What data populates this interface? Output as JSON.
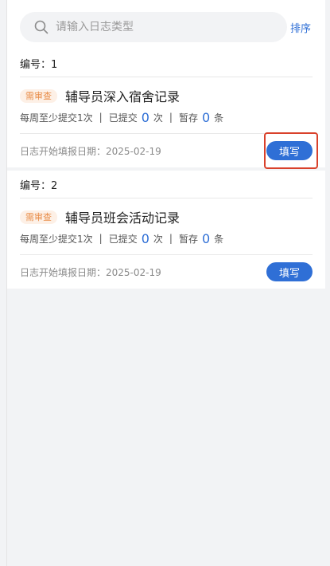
{
  "search": {
    "placeholder": "请输入日志类型",
    "icon": "search-icon"
  },
  "sort_label": "排序",
  "entries": [
    {
      "number_label": "编号：1",
      "tag": "需审查",
      "title": "辅导员深入宿舍记录",
      "frequency": "每周至少提交1次",
      "submitted_prefix": "已提交",
      "submitted_count": "0",
      "submitted_unit": "次",
      "draft_prefix": "暂存",
      "draft_count": "0",
      "draft_unit": "条",
      "separator": "|",
      "start_date": "日志开始填报日期：2025-02-19",
      "button_label": "填写"
    },
    {
      "number_label": "编号：2",
      "tag": "需审查",
      "title": "辅导员班会活动记录",
      "frequency": "每周至少提交1次",
      "submitted_prefix": "已提交",
      "submitted_count": "0",
      "submitted_unit": "次",
      "draft_prefix": "暂存",
      "draft_count": "0",
      "draft_unit": "条",
      "separator": "|",
      "start_date": "日志开始填报日期：2025-02-19",
      "button_label": "填写"
    }
  ],
  "colors": {
    "accent": "#2f6fd6",
    "tag_text": "#e88c47",
    "tag_bg": "#fdf0e6",
    "highlight": "#d9412b"
  }
}
